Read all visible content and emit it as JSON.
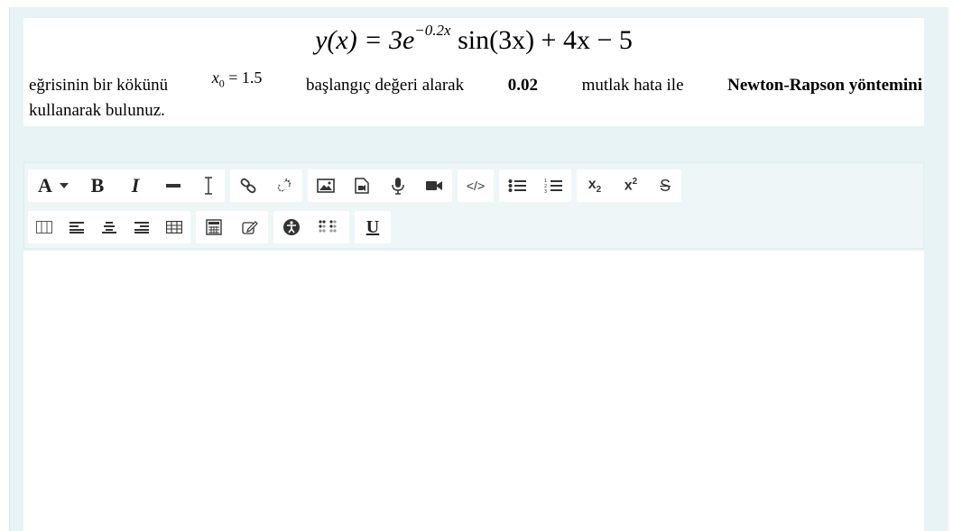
{
  "question": {
    "formula": {
      "lhs": "y(x) = 3e",
      "exponent": "−0.2x",
      "rhs": " sin(3x) + 4x − 5"
    },
    "line1": {
      "before_x0": "eğrisinin bir kökünü",
      "x0_var": "x",
      "x0_sub": "0",
      "x0_value": " = 1.5",
      "after_x0": "başlangıç değeri alarak",
      "error_value": "0.02",
      "mutlak": "mutlak hata ile",
      "method": "Newton-Rapson yöntemini"
    },
    "line2": "kullanarak bulunuz."
  },
  "toolbar": {
    "font_button_label": "A",
    "bold_label": "B",
    "italic_label": "I",
    "subscript_label": "x",
    "subscript_digit": "2",
    "superscript_label": "x",
    "superscript_digit": "2",
    "strike_label": "S",
    "code_label": "</>",
    "underline_label": "U"
  },
  "colors": {
    "panel_bg": "#e7f3f5",
    "toolbar_bg": "#eef6f8",
    "icon": "#333333"
  },
  "icons": {
    "row1": [
      "font-color-icon",
      "bold-icon",
      "italic-icon",
      "horizontal-rule-icon",
      "clear-formatting-icon",
      "link-icon",
      "unlink-icon",
      "image-icon",
      "media-icon",
      "record-audio-icon",
      "record-video-icon",
      "code-icon",
      "bullet-list-icon",
      "numbered-list-icon",
      "subscript-icon",
      "superscript-icon",
      "strikethrough-icon"
    ],
    "row2": [
      "columns-icon",
      "align-left-icon",
      "align-center-icon",
      "align-right-icon",
      "table-icon",
      "calculator-icon",
      "edit-icon",
      "accessibility-icon",
      "braille-icon",
      "underline-icon"
    ]
  }
}
